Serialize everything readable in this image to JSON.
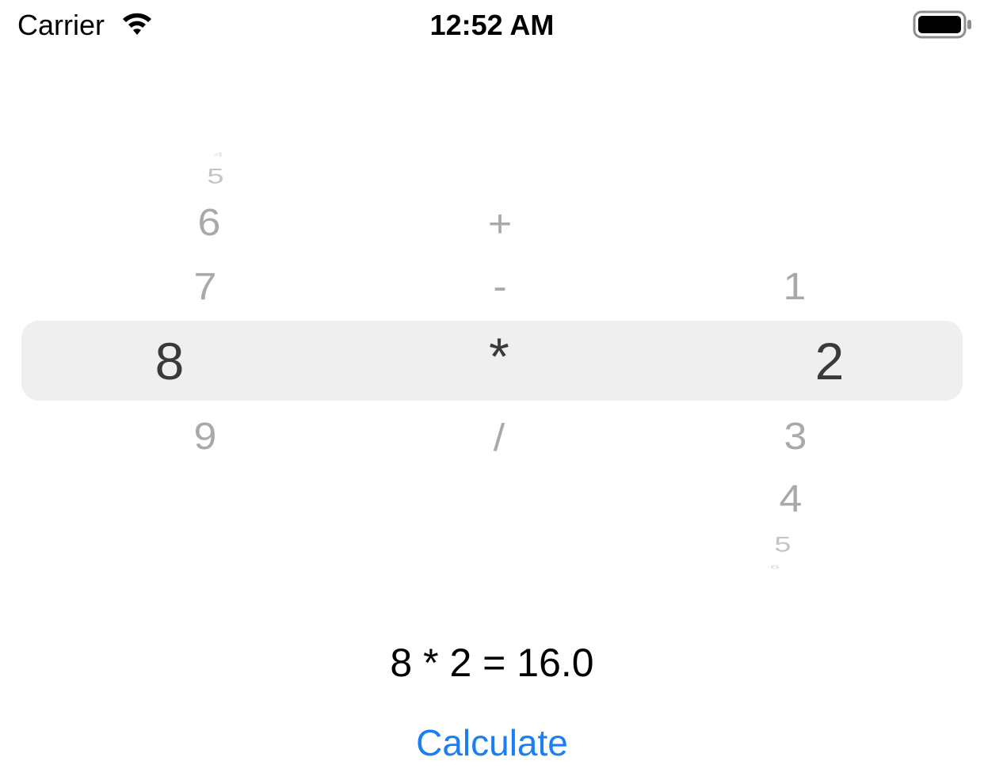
{
  "status_bar": {
    "carrier": "Carrier",
    "time": "12:52 AM",
    "icons": [
      "wifi-icon",
      "battery-icon"
    ]
  },
  "picker": {
    "components": [
      {
        "name": "first-number",
        "items": [
          "4",
          "5",
          "6",
          "7",
          "8",
          "9"
        ],
        "selected": "8"
      },
      {
        "name": "operator",
        "items": [
          "+",
          "-",
          "*",
          "/"
        ],
        "selected": "*"
      },
      {
        "name": "second-number",
        "items": [
          "1",
          "2",
          "3",
          "4",
          "5",
          "6"
        ],
        "selected": "2"
      }
    ]
  },
  "result": {
    "text": "8 * 2 = 16.0"
  },
  "calculate_button": {
    "label": "Calculate"
  },
  "colors": {
    "accent": "#1a7ff2",
    "selection_bar": "#efefef"
  }
}
